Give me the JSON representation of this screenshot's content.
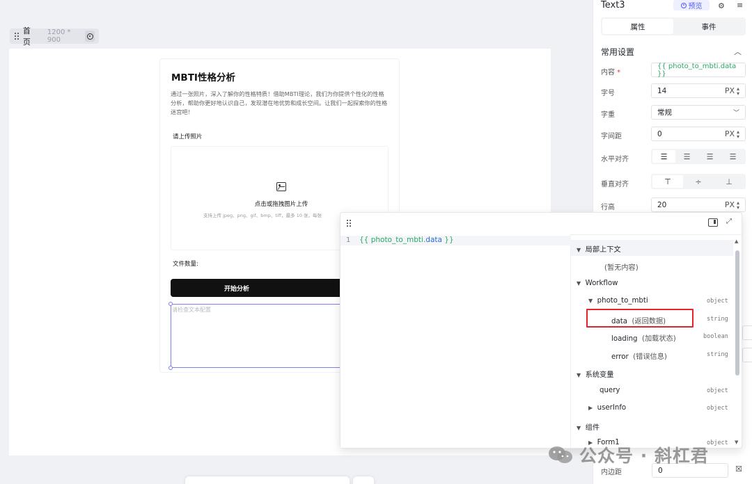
{
  "page_chip": {
    "name": "首页",
    "size": "1200 * 900"
  },
  "canvas_card": {
    "title": "MBTI性格分析",
    "description": "通过一张照片，深入了解你的性格特质！借助MBTI理论，我们为你提供个性化的性格分析，帮助你更好地认识自己，发现潜在地优势和成长空间。让我们一起探索你的性格迷宫吧！",
    "upload_label": "请上传照片",
    "upload_main": "点击或拖拽图片上传",
    "upload_hint": "支持上传 jpeg、png、gif、bmp、tiff，最多 10 张，每张",
    "count_label": "文件数量:",
    "start_button": "开始分析",
    "text_placeholder": "请检查文本配置"
  },
  "panel": {
    "component_name": "Text3",
    "preview_label": "预览",
    "tabs": [
      "属性",
      "事件"
    ],
    "section_title": "常用设置",
    "content_label": "内容",
    "content_value": "{{ photo_to_mbti.data }}",
    "font_size_label": "字号",
    "font_size_value": "14",
    "unit_px": "PX",
    "font_weight_label": "字重",
    "font_weight_value": "常规",
    "letter_spacing_label": "字间距",
    "letter_spacing_value": "0",
    "h_align_label": "水平对齐",
    "v_align_label": "垂直对齐",
    "line_height_label": "行高",
    "line_height_value": "20",
    "padding_label": "内边距",
    "padding_value": "0"
  },
  "editor": {
    "line_number": "1",
    "code_open": "{{ photo_to_mbti.",
    "code_prop": "data",
    "code_close": " }}"
  },
  "tree": {
    "local_context": "局部上下文",
    "empty": "(暂无内容)",
    "workflow": "Workflow",
    "workflow_node": "photo_to_mbti",
    "workflow_node_type": "object",
    "items": [
      {
        "name": "data",
        "note": "(返回数据)",
        "type": "string"
      },
      {
        "name": "loading",
        "note": "(加载状态)",
        "type": "boolean"
      },
      {
        "name": "error",
        "note": "(错误信息)",
        "type": "string"
      }
    ],
    "system_vars": "系统变量",
    "query": "query",
    "query_type": "object",
    "userinfo": "userInfo",
    "userinfo_type": "object",
    "components": "组件",
    "form1": "Form1",
    "form1_type": "object"
  },
  "watermark": "公众号 · 斜杠君"
}
